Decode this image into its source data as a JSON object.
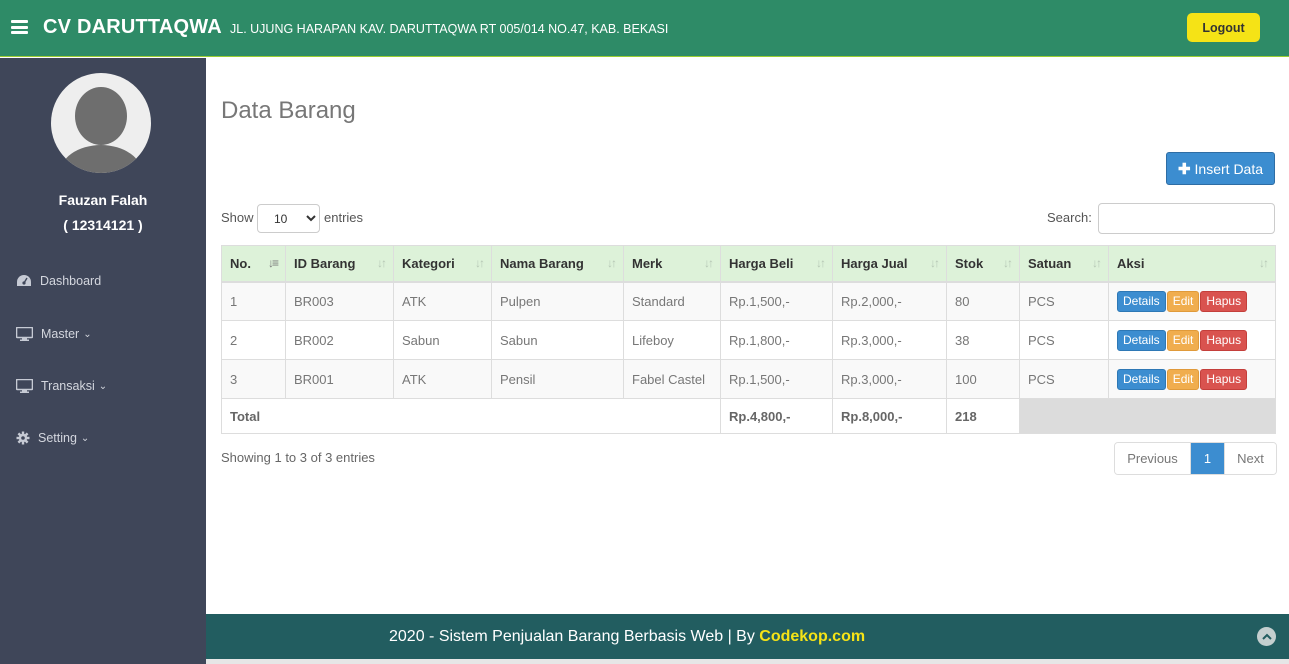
{
  "header": {
    "brand": "CV DARUTTAQWA",
    "address": "JL. UJUNG HARAPAN KAV. DARUTTAQWA RT 005/014 NO.47, KAB. BEKASI",
    "logout_label": "Logout"
  },
  "user": {
    "name": "Fauzan Falah",
    "id": "( 12314121 )"
  },
  "sidebar": {
    "items": [
      {
        "label": "Dashboard",
        "icon": "dashboard-icon",
        "has_submenu": false
      },
      {
        "label": "Master",
        "icon": "monitor-icon",
        "has_submenu": true
      },
      {
        "label": "Transaksi",
        "icon": "monitor-icon",
        "has_submenu": true
      },
      {
        "label": "Setting",
        "icon": "gear-icon",
        "has_submenu": true
      }
    ]
  },
  "page": {
    "title": "Data Barang",
    "insert_label": "Insert Data"
  },
  "table_controls": {
    "show_label": "Show",
    "entries_value": "10",
    "entries_label": "entries",
    "search_label": "Search:",
    "search_value": ""
  },
  "table": {
    "columns": [
      "No.",
      "ID Barang",
      "Kategori",
      "Nama Barang",
      "Merk",
      "Harga Beli",
      "Harga Jual",
      "Stok",
      "Satuan",
      "Aksi"
    ],
    "rows": [
      {
        "no": "1",
        "id": "BR003",
        "kategori": "ATK",
        "nama": "Pulpen",
        "merk": "Standard",
        "beli": "Rp.1,500,-",
        "jual": "Rp.2,000,-",
        "stok": "80",
        "satuan": "PCS"
      },
      {
        "no": "2",
        "id": "BR002",
        "kategori": "Sabun",
        "nama": "Sabun",
        "merk": "Lifeboy",
        "beli": "Rp.1,800,-",
        "jual": "Rp.3,000,-",
        "stok": "38",
        "satuan": "PCS"
      },
      {
        "no": "3",
        "id": "BR001",
        "kategori": "ATK",
        "nama": "Pensil",
        "merk": "Fabel Castel",
        "beli": "Rp.1,500,-",
        "jual": "Rp.3,000,-",
        "stok": "100",
        "satuan": "PCS"
      }
    ],
    "actions": {
      "details": "Details",
      "edit": "Edit",
      "hapus": "Hapus"
    },
    "footer": {
      "label": "Total",
      "beli": "Rp.4,800,-",
      "jual": "Rp.8,000,-",
      "stok": "218"
    }
  },
  "pagination": {
    "info": "Showing 1 to 3 of 3 entries",
    "prev": "Previous",
    "current": "1",
    "next": "Next"
  },
  "footer": {
    "text": "2020 - Sistem Penjualan Barang Berbasis Web | By ",
    "link": "Codekop.com"
  },
  "colors": {
    "topbar": "#2e8b67",
    "sidebar": "#3f4659",
    "footer": "#225d60",
    "accent_yellow": "#f5e316",
    "primary": "#3c8dd0"
  }
}
